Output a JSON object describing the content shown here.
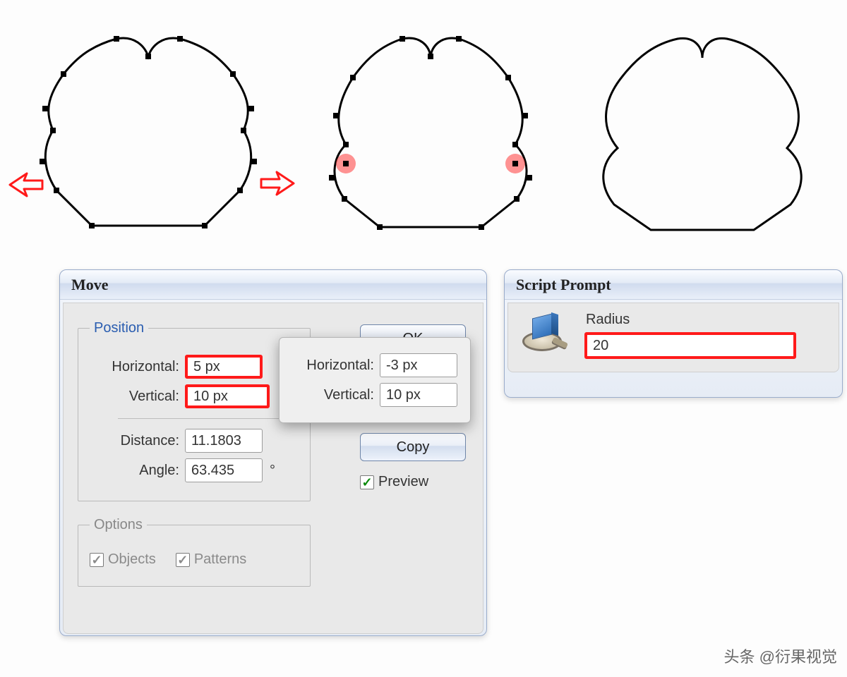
{
  "shapes": {
    "arrow_left_name": "arrow-right-icon",
    "arrow_right_name": "arrow-left-icon"
  },
  "move_dialog": {
    "title": "Move",
    "position": {
      "legend": "Position",
      "horizontal_label": "Horizontal:",
      "horizontal_value": "5 px",
      "vertical_label": "Vertical:",
      "vertical_value": "10 px",
      "distance_label": "Distance:",
      "distance_value": "11.1803",
      "angle_label": "Angle:",
      "angle_value": "63.435",
      "angle_unit": "°"
    },
    "options": {
      "legend": "Options",
      "objects_label": "Objects",
      "objects_checked": true,
      "patterns_label": "Patterns",
      "patterns_checked": true
    },
    "buttons": {
      "ok": "OK",
      "copy": "Copy"
    },
    "preview": {
      "label": "Preview",
      "checked": true
    }
  },
  "overlay": {
    "horizontal_label": "Horizontal:",
    "horizontal_value": "-3 px",
    "vertical_label": "Vertical:",
    "vertical_value": "10 px"
  },
  "script_dialog": {
    "title": "Script Prompt",
    "radius_label": "Radius",
    "radius_value": "20"
  },
  "watermark": "头条 @衍果视觉"
}
